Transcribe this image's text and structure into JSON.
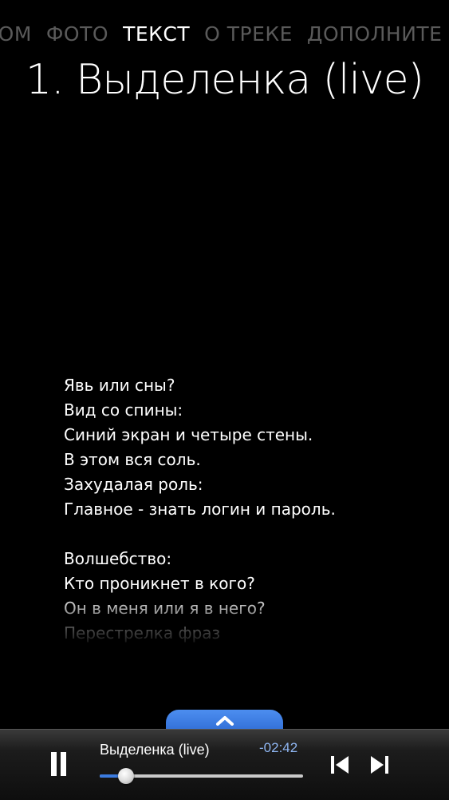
{
  "tabs": [
    {
      "label": "ЬОМ",
      "active": false
    },
    {
      "label": "ФОТО",
      "active": false
    },
    {
      "label": "ТЕКСТ",
      "active": true
    },
    {
      "label": "О ТРЕКЕ",
      "active": false
    },
    {
      "label": "ДОПОЛНИТЕ",
      "active": false
    }
  ],
  "title": "1. Выделенка (live)",
  "lyrics": [
    "Явь или сны?",
    "Вид со спины:",
    "Синий экран и четыре стены.",
    "В этом вся соль.",
    "Захудалая роль:",
    "Главное - знать логин и пароль.",
    "",
    "Волшебство:",
    "Кто проникнет в кого?",
    "Он в меня или я в него?",
    "Перестрелка фраз"
  ],
  "player": {
    "track_name": "Выделенка (live)",
    "remaining_time": "-02:42",
    "progress_fraction": 0.13,
    "pause_icon": "pause-icon",
    "prev_icon": "skip-previous-icon",
    "next_icon": "skip-next-icon",
    "expand_icon": "chevron-up-icon"
  },
  "colors": {
    "background": "#000000",
    "tab_inactive": "#5a5a5a",
    "tab_active": "#ffffff",
    "accent": "#3b7be0",
    "time_text": "#8fb6f2"
  }
}
